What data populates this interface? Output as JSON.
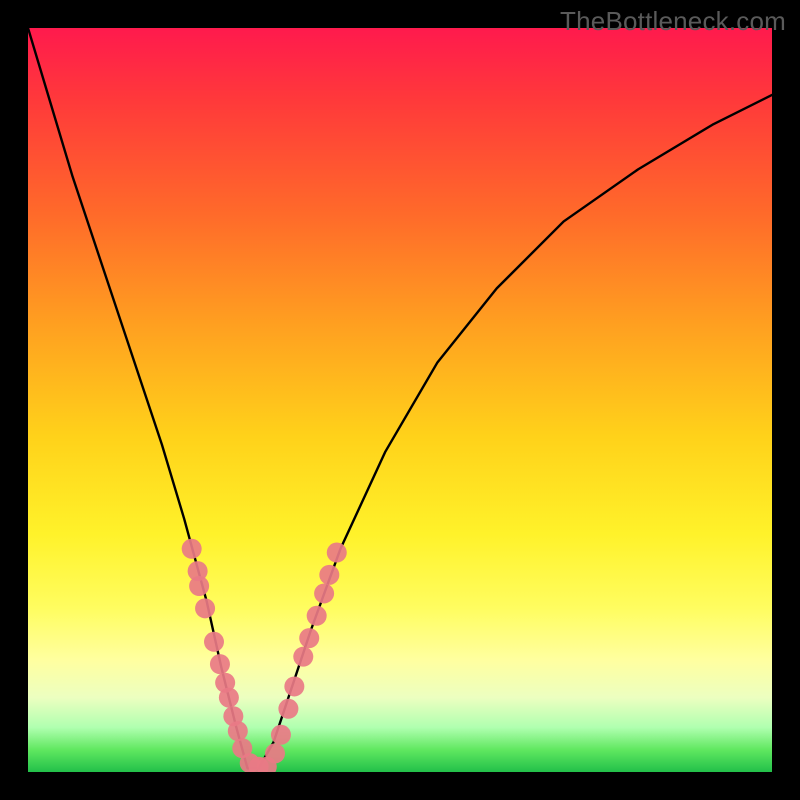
{
  "watermark": "TheBottleneck.com",
  "chart_data": {
    "type": "line",
    "title": "",
    "xlabel": "",
    "ylabel": "",
    "xlim": [
      0,
      100
    ],
    "ylim": [
      0,
      100
    ],
    "curve": {
      "name": "bottleneck-curve",
      "x": [
        0,
        3,
        6,
        10,
        14,
        18,
        21,
        24,
        26,
        28,
        29.5,
        31,
        33,
        35,
        38,
        42,
        48,
        55,
        63,
        72,
        82,
        92,
        100
      ],
      "y": [
        100,
        90,
        80,
        68,
        56,
        44,
        34,
        23,
        14,
        6,
        0.5,
        0.5,
        4,
        10,
        19,
        30,
        43,
        55,
        65,
        74,
        81,
        87,
        91
      ]
    },
    "markers": {
      "name": "data-points",
      "color": "#e97a86",
      "radius": 10,
      "points": [
        {
          "x": 22.0,
          "y": 30.0
        },
        {
          "x": 22.8,
          "y": 27.0
        },
        {
          "x": 23.0,
          "y": 25.0
        },
        {
          "x": 23.8,
          "y": 22.0
        },
        {
          "x": 25.0,
          "y": 17.5
        },
        {
          "x": 25.8,
          "y": 14.5
        },
        {
          "x": 26.5,
          "y": 12.0
        },
        {
          "x": 27.0,
          "y": 10.0
        },
        {
          "x": 27.6,
          "y": 7.5
        },
        {
          "x": 28.2,
          "y": 5.5
        },
        {
          "x": 28.8,
          "y": 3.2
        },
        {
          "x": 29.8,
          "y": 1.2
        },
        {
          "x": 31.0,
          "y": 0.7
        },
        {
          "x": 32.1,
          "y": 0.7
        },
        {
          "x": 33.2,
          "y": 2.5
        },
        {
          "x": 34.0,
          "y": 5.0
        },
        {
          "x": 35.0,
          "y": 8.5
        },
        {
          "x": 35.8,
          "y": 11.5
        },
        {
          "x": 37.0,
          "y": 15.5
        },
        {
          "x": 37.8,
          "y": 18.0
        },
        {
          "x": 38.8,
          "y": 21.0
        },
        {
          "x": 39.8,
          "y": 24.0
        },
        {
          "x": 40.5,
          "y": 26.5
        },
        {
          "x": 41.5,
          "y": 29.5
        }
      ]
    }
  }
}
